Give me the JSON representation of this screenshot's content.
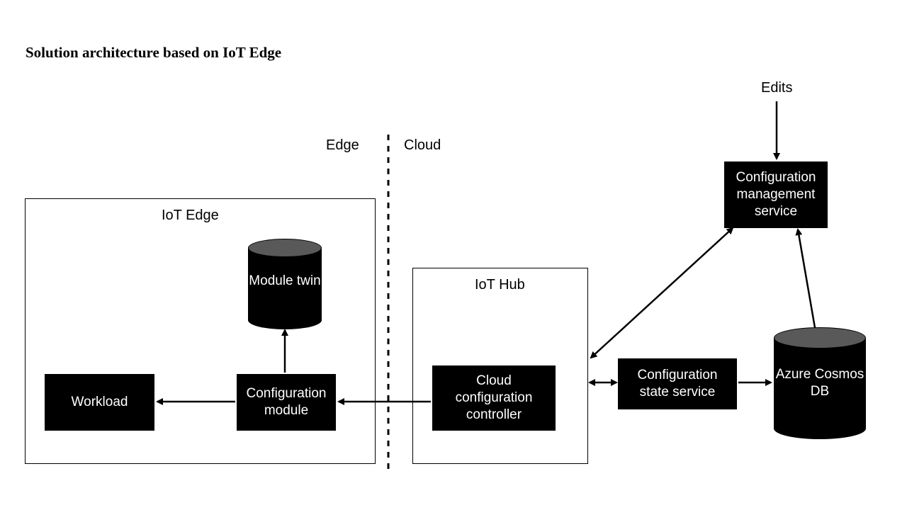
{
  "title": "Solution architecture based on IoT Edge",
  "regions": {
    "edge_label": "Edge",
    "cloud_label": "Cloud"
  },
  "containers": {
    "iot_edge": "IoT Edge",
    "iot_hub": "IoT Hub"
  },
  "nodes": {
    "workload": "Workload",
    "config_module": "Configuration module",
    "module_twin": "Module twin",
    "cloud_config_controller": "Cloud configuration controller",
    "config_state_service": "Configuration state service",
    "config_mgmt_service": "Configuration management service",
    "cosmos_db": "Azure Cosmos DB",
    "edits_label": "Edits"
  }
}
